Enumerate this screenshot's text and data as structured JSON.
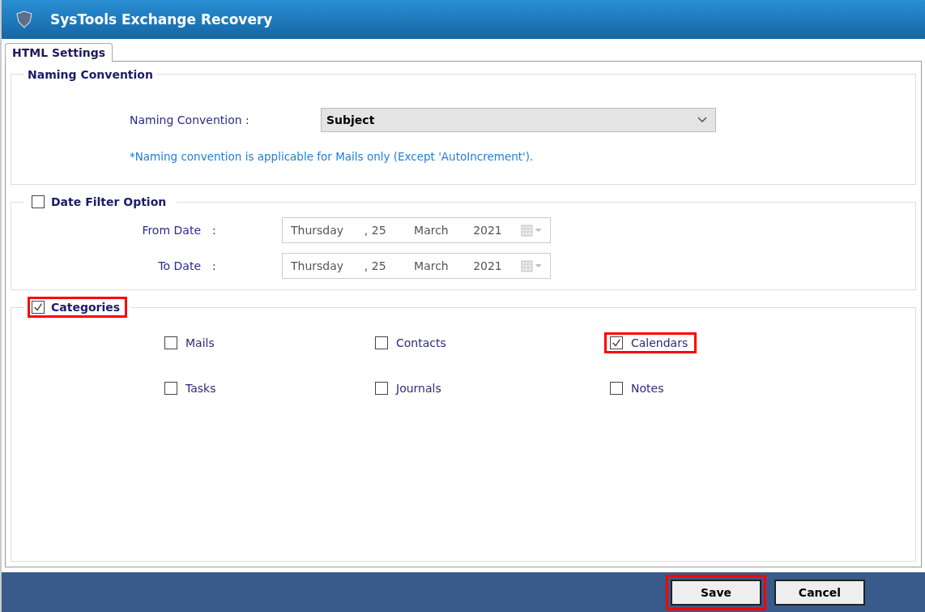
{
  "window": {
    "title": "SysTools  Exchange Recovery"
  },
  "tabs": [
    {
      "label": "HTML Settings",
      "selected": true
    }
  ],
  "naming": {
    "legend": "Naming Convention",
    "label": "Naming Convention :",
    "value": "Subject",
    "note": "*Naming convention is applicable for Mails only (Except 'AutoIncrement')."
  },
  "date_filter": {
    "legend": "Date Filter Option",
    "checked": false,
    "highlighted": false,
    "fields": [
      {
        "label": "From Date",
        "colon": ":",
        "weekday": "Thursday",
        "day": ", 25",
        "month": "March",
        "year": "2021"
      },
      {
        "label": "To Date",
        "colon": ":",
        "weekday": "Thursday",
        "day": ", 25",
        "month": "March",
        "year": "2021"
      }
    ]
  },
  "categories": {
    "legend": "Categories",
    "checked": true,
    "highlighted": true,
    "items": [
      {
        "label": "Mails",
        "checked": false,
        "highlighted": false
      },
      {
        "label": "Contacts",
        "checked": false,
        "highlighted": false
      },
      {
        "label": "Calendars",
        "checked": true,
        "highlighted": true
      },
      {
        "label": "Tasks",
        "checked": false,
        "highlighted": false
      },
      {
        "label": "Journals",
        "checked": false,
        "highlighted": false
      },
      {
        "label": "Notes",
        "checked": false,
        "highlighted": false
      }
    ]
  },
  "buttons": [
    {
      "label": "Save",
      "highlighted": true
    },
    {
      "label": "Cancel",
      "highlighted": false
    }
  ]
}
